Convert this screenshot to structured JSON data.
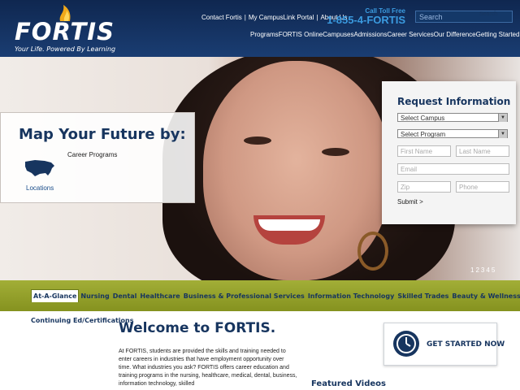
{
  "brand": {
    "logo_text": "FORTIS",
    "tagline": "Your Life. Powered By Learning"
  },
  "header": {
    "utility_links": [
      "Contact Fortis",
      "My CampusLink Portal",
      "About Us"
    ],
    "toll_free_label": "Call Toll Free",
    "toll_free_number": "1-855-4-FORTIS",
    "search_placeholder": "Search",
    "search_button": "Search",
    "nav": [
      "Programs",
      "FORTIS Online",
      "Campuses",
      "Admissions",
      "Career Services",
      "Our Difference",
      "Getting Started"
    ]
  },
  "hero": {
    "map_title": "Map Your Future by:",
    "programs_link": "Career Programs",
    "locations_link": "Locations",
    "pager": [
      "1",
      "2",
      "3",
      "4",
      "5"
    ]
  },
  "request_form": {
    "title": "Request Information",
    "campus_select": "Select Campus",
    "program_select": "Select Program",
    "first_name": "First Name",
    "last_name": "Last Name",
    "email": "Email",
    "zip": "Zip",
    "phone": "Phone",
    "submit": "Submit >"
  },
  "tabs": [
    "At-A-Glance",
    "Nursing",
    "Dental",
    "Healthcare",
    "Business & Professional Services",
    "Information Technology",
    "Skilled Trades",
    "Beauty & Wellness"
  ],
  "content": {
    "continuing_ed": "Continuing Ed/Certifications",
    "welcome_title": "Welcome to FORTIS.",
    "body": "At FORTIS, students are provided the skills and training needed to enter careers in industries that have employment opportunity over time. What industries you ask?  FORTIS offers career education and training programs in the nursing, healthcare, medical, dental, business, information technology, skilled",
    "get_started": "GET STARTED NOW",
    "featured_videos": "Featured Videos"
  },
  "colors": {
    "navy": "#17355f",
    "accent_blue": "#3b9be0",
    "olive": "#95a12a"
  }
}
